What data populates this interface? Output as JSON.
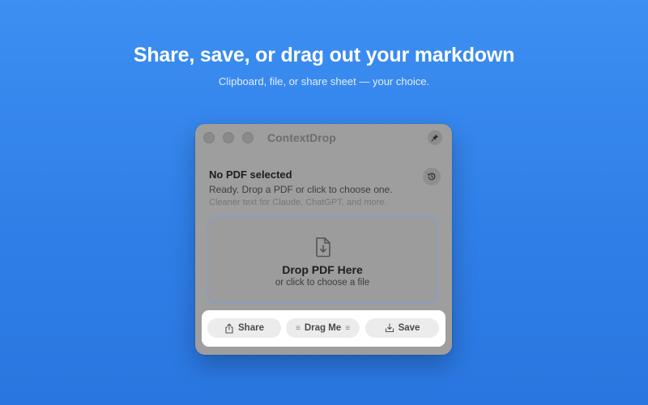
{
  "hero": {
    "title": "Share, save, or drag out your markdown",
    "subtitle": "Clipboard, file, or share sheet — your choice."
  },
  "window": {
    "title": "ContextDrop",
    "icons": {
      "pin": "pin-icon",
      "history": "history-icon"
    }
  },
  "status": {
    "title": "No PDF selected",
    "message": "Ready. Drop a PDF or click to choose one.",
    "hint": "Cleaner text for Claude, ChatGPT, and more."
  },
  "dropzone": {
    "icon": "document-download-icon",
    "title": "Drop PDF Here",
    "subtitle": "or click to choose a file"
  },
  "actions": {
    "share_label": "Share",
    "drag_label": "Drag Me",
    "drag_grip": "≡",
    "save_label": "Save"
  },
  "colors": {
    "background": "#3388ee",
    "accent_border": "#7a9fd6",
    "window_dimmed": "#9e9e9e",
    "action_bar": "#ffffff"
  }
}
